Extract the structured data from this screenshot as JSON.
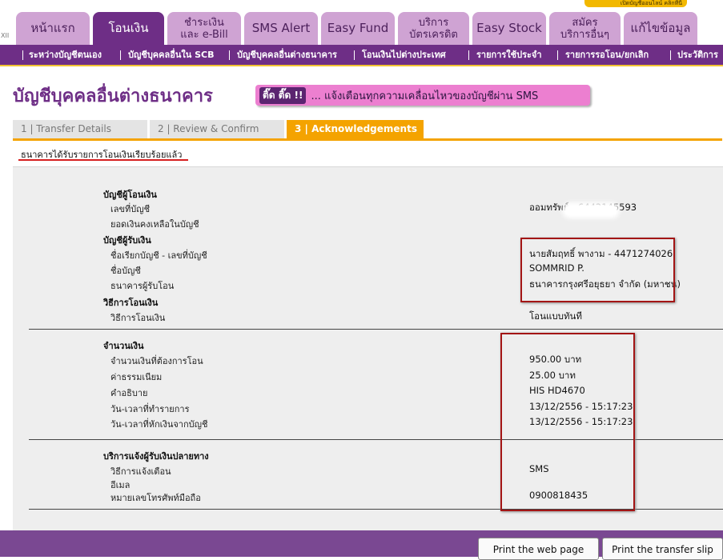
{
  "promo": "เปิดบัญชีออนไลน์ คลิกที่นี่",
  "corner_label": "XII",
  "tabs": [
    {
      "label": "หน้าแรก",
      "active": false
    },
    {
      "label": "โอนเงิน",
      "active": true
    },
    {
      "label": "ชำระเงิน\nและ e-Bill",
      "active": false
    },
    {
      "label": "SMS Alert",
      "active": false
    },
    {
      "label": "Easy Fund",
      "active": false
    },
    {
      "label": "บริการ\nบัตรเครดิต",
      "active": false
    },
    {
      "label": "Easy Stock",
      "active": false
    },
    {
      "label": "สมัคร\nบริการอื่นๆ",
      "active": false
    },
    {
      "label": "แก้ไขข้อมูล",
      "active": false
    }
  ],
  "subnav": [
    "ระหว่างบัญชีตนเอง",
    "บัญชีบุคคลอื่นใน SCB",
    "บัญชีบุคคลอื่นต่างธนาคาร",
    "โอนเงินไปต่างประเทศ",
    "รายการใช้ประจำ",
    "รายการรอโอน/ยกเลิก",
    "ประวัติการ"
  ],
  "page_title": "บัญชีบุคคลอื่นต่างธนาคาร",
  "sms_banner": {
    "badge": "ติ๊ด ติ๊ด !!",
    "message": "... แจ้งเตือนทุกความเคลื่อนไหวของบัญชีผ่าน SMS"
  },
  "steps": [
    {
      "label": "1 | Transfer Details",
      "active": false
    },
    {
      "label": "2 | Review & Confirm",
      "active": false
    },
    {
      "label": "3 | Acknowledgements",
      "active": true
    }
  ],
  "success_message": "ธนาคารได้รับรายการโอนเงินเรียบร้อยแล้ว",
  "sections": {
    "from_account": {
      "heading": "บัญชีผู้โอนเงิน",
      "account_no_label": "เลขที่บัญชี",
      "account_no": "ออมทรัพย์ - 6442145593",
      "balance_label": "ยอดเงินคงเหลือในบัญชี"
    },
    "to_account": {
      "heading": "บัญชีผู้รับเงิน",
      "nickname_label": "ชื่อเรียกบัญชี - เลขที่บัญชี",
      "nickname": "นายสัมฤทธิ์ พางาม - 4471274026",
      "account_name_label": "ชื่อบัญชี",
      "account_name": "SOMMRID P.",
      "bank_label": "ธนาคารผู้รับโอน",
      "bank": "ธนาคารกรุงศรีอยุธยา จำกัด (มหาชน)"
    },
    "method": {
      "heading": "วิธีการโอนเงิน",
      "method_label": "วิธีการโอนเงิน",
      "method": "โอนแบบทันที"
    },
    "amount": {
      "heading": "จำนวนเงิน",
      "amount_label": "จำนวนเงินที่ต้องการโอน",
      "amount": "950.00  บาท",
      "fee_label": "ค่าธรรมเนียม",
      "fee": "25.00  บาท",
      "description_label": "คำอธิบาย",
      "description": "HIS HD4670",
      "txn_time_label": "วัน-เวลาที่ทำรายการ",
      "txn_time": "13/12/2556 - 15:17:23",
      "debit_time_label": "วัน-เวลาที่หักเงินจากบัญชี",
      "debit_time": "13/12/2556 - 15:17:23"
    },
    "notify": {
      "heading": "บริการแจ้งผู้รับเงินปลายทาง",
      "method_label": "วิธีการแจ้งเตือน",
      "method": "SMS",
      "email_label": "อีเมล",
      "phone_label": "หมายเลขโทรศัพท์มือถือ",
      "phone": "0900818435"
    }
  },
  "buttons": {
    "print_page": "Print the web page",
    "print_slip": "Print the transfer slip"
  }
}
